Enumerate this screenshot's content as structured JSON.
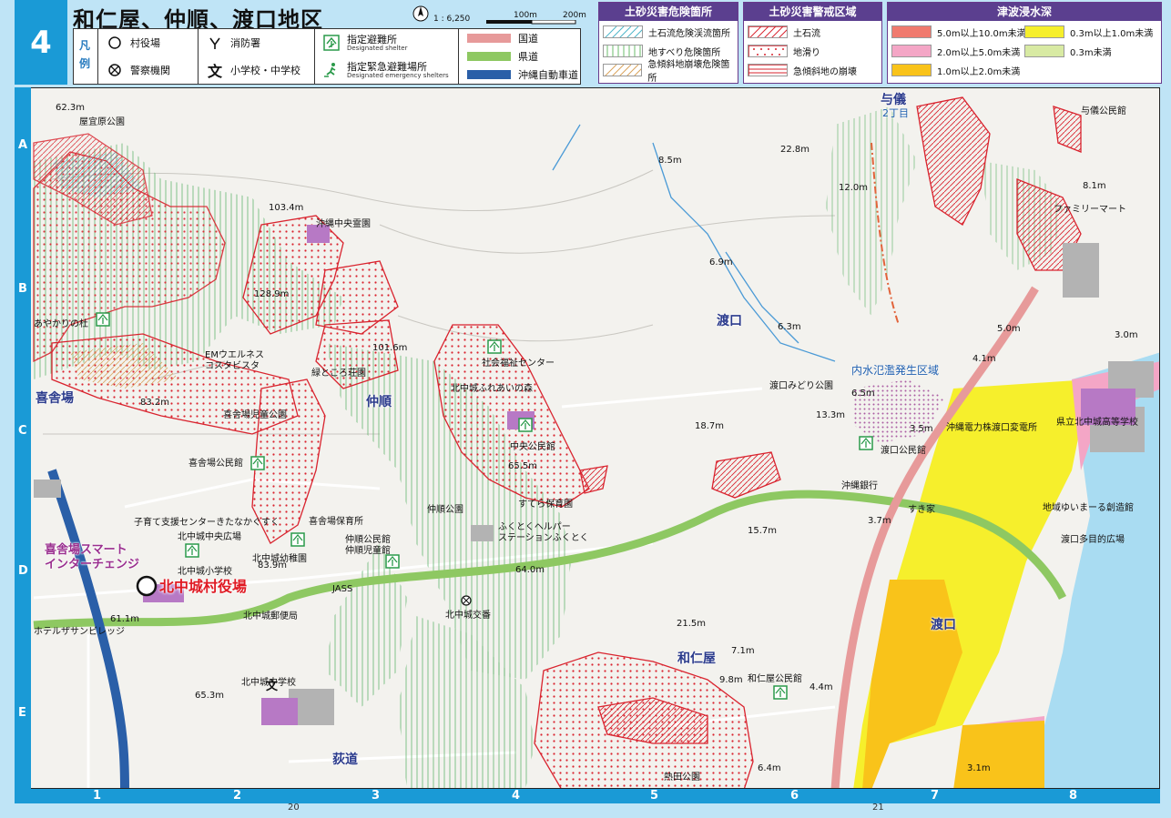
{
  "header": {
    "page_number": "4",
    "title": "和仁屋、仲順、渡口地区",
    "scale_text": "1 : 6,250",
    "scale_100": "100m",
    "scale_200": "200m"
  },
  "legend": {
    "kanji": "凡例",
    "items": [
      {
        "label": "村役場",
        "icon": "village-office-icon"
      },
      {
        "label": "警察機関",
        "icon": "police-icon"
      },
      {
        "label": "消防署",
        "icon": "fire-station-icon"
      },
      {
        "label": "小学校・中学校",
        "icon": "school-icon"
      },
      {
        "label": "指定避難所",
        "sub": "Designated shelter",
        "icon": "shelter-icon"
      },
      {
        "label": "指定緊急避難場所",
        "sub": "Designated emergency shelters",
        "icon": "emergency-shelter-icon"
      }
    ],
    "roads": [
      {
        "label": "国道",
        "color": "#e79a9a"
      },
      {
        "label": "県道",
        "color": "#8ec862"
      },
      {
        "label": "沖縄自動車道",
        "color": "#2a5fa8"
      }
    ]
  },
  "panels": {
    "sediment_danger": {
      "title": "土砂災害危険箇所",
      "items": [
        "土石流危険渓流箇所",
        "地すべり危険箇所",
        "急傾斜地崩壊危険箇所"
      ]
    },
    "sediment_warning": {
      "title": "土砂災害警戒区域",
      "items": [
        "土石流",
        "地滑り",
        "急傾斜地の崩壊"
      ]
    },
    "tsunami": {
      "title": "津波浸水深",
      "items": [
        {
          "label": "5.0m以上10.0m未満",
          "color": "#f07a6e"
        },
        {
          "label": "0.3m以上1.0m未満",
          "color": "#f6ef2c"
        },
        {
          "label": "2.0m以上5.0m未満",
          "color": "#f4a6c6"
        },
        {
          "label": "0.3m未満",
          "color": "#d8eaa3"
        },
        {
          "label": "1.0m以上2.0m未満",
          "color": "#f9c31a"
        }
      ]
    }
  },
  "grid": {
    "rows": [
      "A",
      "B",
      "C",
      "D",
      "E"
    ],
    "cols": [
      "1",
      "2",
      "3",
      "4",
      "5",
      "6",
      "7",
      "8"
    ],
    "page_left": "20",
    "page_right": "21"
  },
  "map": {
    "areas": [
      "喜舎場",
      "仲順",
      "渡口",
      "和仁屋",
      "荻道",
      "与儀",
      "渡口"
    ],
    "aza_sub": "2丁目",
    "office_label": "北中城村役場",
    "interchange": "喜舎場スマート\nインターチェンジ",
    "flood_area": "内水氾濫発生区域",
    "places": [
      "屋宜原公園",
      "沖縄中央霊園",
      "あやかりの杜",
      "EMウエルネス\nコスタビスタ",
      "緑ところ荘園",
      "喜舎場児童公園",
      "喜舎場公民館",
      "社会福祉センター",
      "北中城ふれあいの森",
      "中央公民館",
      "すてら保育園",
      "仲順公園",
      "ふくとくヘルパー\nステーションふくとく",
      "子育て支援センターきたなかぐすく",
      "喜舎場保育所",
      "北中城中央広場",
      "北中城小学校",
      "北中城幼稚園",
      "仲順公民館\n仲順児童館",
      "JASS",
      "北中城交番",
      "北中城郵便局",
      "ホテルザサンビレッジ",
      "北中城中学校",
      "和仁屋公民館",
      "熱田公園",
      "渡口みどり公園",
      "渡口公民館",
      "沖縄電力株渡口変電所",
      "沖縄銀行",
      "すき家",
      "県立北中城高等学校",
      "地域ゆいまーる創造館",
      "渡口多目的広場",
      "与儀公民館",
      "ファミリーマート"
    ],
    "elevations": [
      "62.3m",
      "103.4m",
      "128.9m",
      "101.6m",
      "83.2m",
      "65.5m",
      "83.9m",
      "64.0m",
      "61.1m",
      "65.3m",
      "21.5m",
      "7.1m",
      "9.8m",
      "4.4m",
      "6.4m",
      "3.1m",
      "8.5m",
      "22.8m",
      "12.0m",
      "8.1m",
      "6.9m",
      "6.3m",
      "5.0m",
      "4.1m",
      "3.0m",
      "6.5m",
      "13.3m",
      "3.5m",
      "18.7m",
      "3.7m",
      "15.7m"
    ]
  }
}
